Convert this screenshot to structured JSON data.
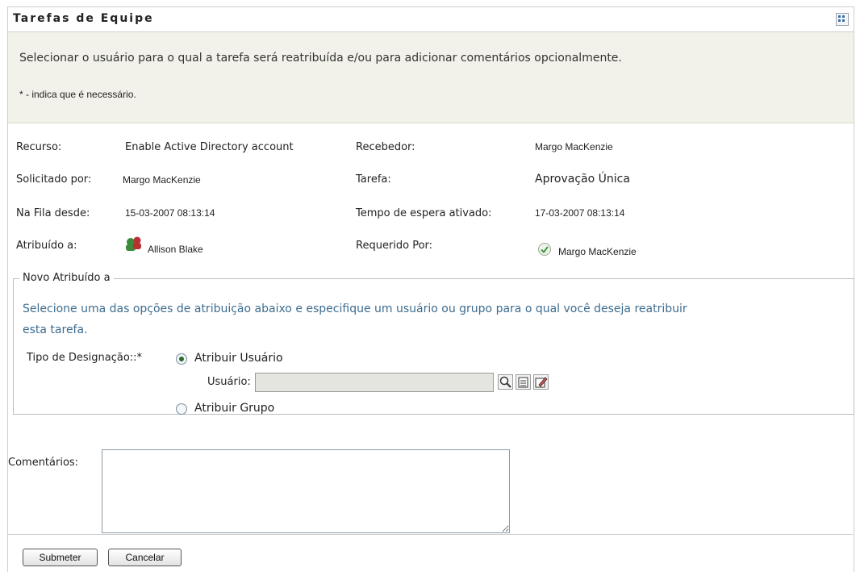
{
  "header": {
    "title": "Tarefas de Equipe"
  },
  "instructions": {
    "main": "Selecionar o usuário para o qual a tarefa será reatribuída e/ou para adicionar comentários opcionalmente.",
    "required_note": "* - indica que é necessário."
  },
  "details": {
    "recurso_label": "Recurso:",
    "recurso_value": "Enable Active Directory account",
    "recebedor_label": "Recebedor:",
    "recebedor_value": "Margo MacKenzie",
    "solicitado_label": "Solicitado por:",
    "solicitado_value": "Margo MacKenzie",
    "tarefa_label": "Tarefa:",
    "tarefa_value": "Aprovação Única",
    "fila_label": "Na Fila desde:",
    "fila_value": "15-03-2007 08:13:14",
    "tempo_label": "Tempo de espera ativado:",
    "tempo_value": "17-03-2007 08:13:14",
    "atribuido_label": "Atribuído a:",
    "atribuido_value": "Allison Blake",
    "requerido_label": "Requerido Por:",
    "requerido_value": "Margo MacKenzie"
  },
  "new_assignee": {
    "legend": "Novo Atribuído a",
    "description_line1": "Selecione uma das opções de atribuição abaixo e especifique um usuário ou grupo para o qual você deseja reatribuir",
    "description_line2": "esta tarefa.",
    "type_label": "Tipo de Designação::*",
    "option_user": "Atribuir Usuário",
    "user_label": "Usuário:",
    "user_value": "",
    "option_group": "Atribuir Grupo"
  },
  "comments": {
    "label": "Comentários:",
    "value": ""
  },
  "buttons": {
    "submit": "Submeter",
    "cancel": "Cancelar"
  }
}
